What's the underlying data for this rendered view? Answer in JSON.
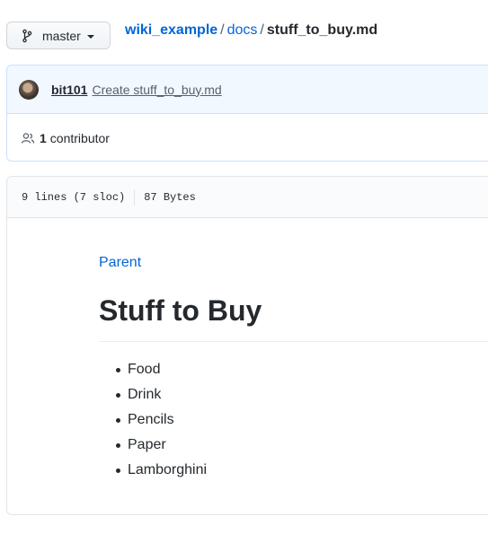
{
  "branch": {
    "label": "master",
    "icon": "git-branch-icon"
  },
  "breadcrumb": {
    "repo": "wiki_example",
    "sep1": "/",
    "folder": "docs",
    "sep2": "/",
    "file": "stuff_to_buy.md"
  },
  "commit": {
    "author": "bit101",
    "message": "Create stuff_to_buy.md",
    "contributors_count": "1",
    "contributors_label": "contributor"
  },
  "file_info": {
    "lines": "9 lines (7 sloc)",
    "size": "87 Bytes"
  },
  "content": {
    "parent_link": "Parent",
    "title": "Stuff to Buy",
    "items": [
      "Food",
      "Drink",
      "Pencils",
      "Paper",
      "Lamborghini"
    ]
  },
  "colors": {
    "link": "#0366d6",
    "commit_bg": "#f1f8ff",
    "text": "#24292e"
  }
}
